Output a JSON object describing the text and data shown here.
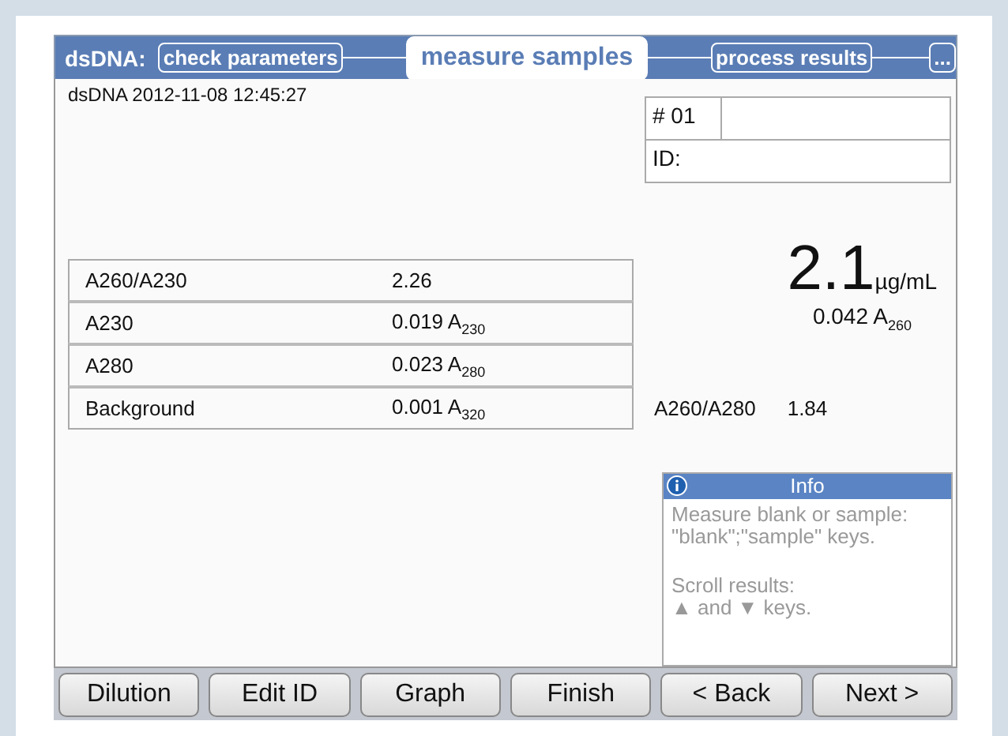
{
  "header": {
    "title": "dsDNA:",
    "steps": [
      {
        "label": "check parameters",
        "selected": false
      },
      {
        "label": "measure samples",
        "selected": true
      },
      {
        "label": "process results",
        "selected": false
      },
      {
        "label": "...",
        "selected": false
      }
    ]
  },
  "timestamp": "dsDNA 2012-11-08 12:45:27",
  "sample": {
    "number": "# 01",
    "id_label": "ID:"
  },
  "table": {
    "rows": [
      {
        "label": "A260/A230",
        "value": "2.26"
      },
      {
        "label": "A230",
        "value": "0.019 A$_{230}$"
      },
      {
        "label": "A280",
        "value": "0.023 A$_{280}$"
      },
      {
        "label": "Background",
        "value": "0.001 A$_{320}$"
      }
    ]
  },
  "result": {
    "value": "2.1",
    "unit": "µg/mL",
    "absorbance": "0.042 A$_{260}$"
  },
  "ratio": {
    "label": "A260/A280",
    "value": "1.84"
  },
  "info": {
    "title": "Info",
    "paragraphs": [
      "Measure blank or sample:\n\"blank\";\"sample\" keys.",
      "Scroll results:\n▲ and ▼ keys."
    ]
  },
  "buttons": [
    "Dilution",
    "Edit ID",
    "Graph",
    "Finish",
    "< Back",
    "Next >"
  ]
}
